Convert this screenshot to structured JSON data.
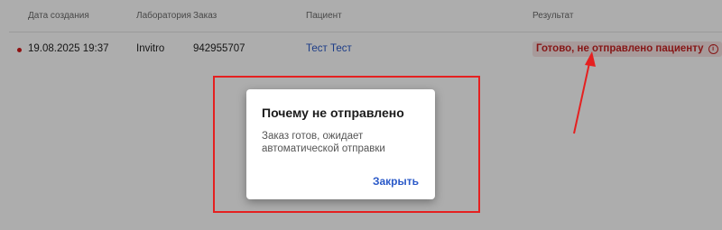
{
  "table": {
    "headers": {
      "date": "Дата создания",
      "lab": "Лаборатория",
      "order": "Заказ",
      "patient": "Пациент",
      "result": "Результат"
    },
    "rows": [
      {
        "date": "19.08.2025 19:37",
        "lab": "Invitro",
        "order": "942955707",
        "patient": "Тест Тест",
        "result": "Готово, не отправлено пациенту",
        "result_icon": "info-icon"
      }
    ]
  },
  "dialog": {
    "title": "Почему не отправлено",
    "body": "Заказ готов, ожидает автоматической отправки",
    "close_label": "Закрыть"
  },
  "colors": {
    "accent_link": "#2a59c8",
    "status_red": "#c62323",
    "highlight": "#e52020"
  }
}
